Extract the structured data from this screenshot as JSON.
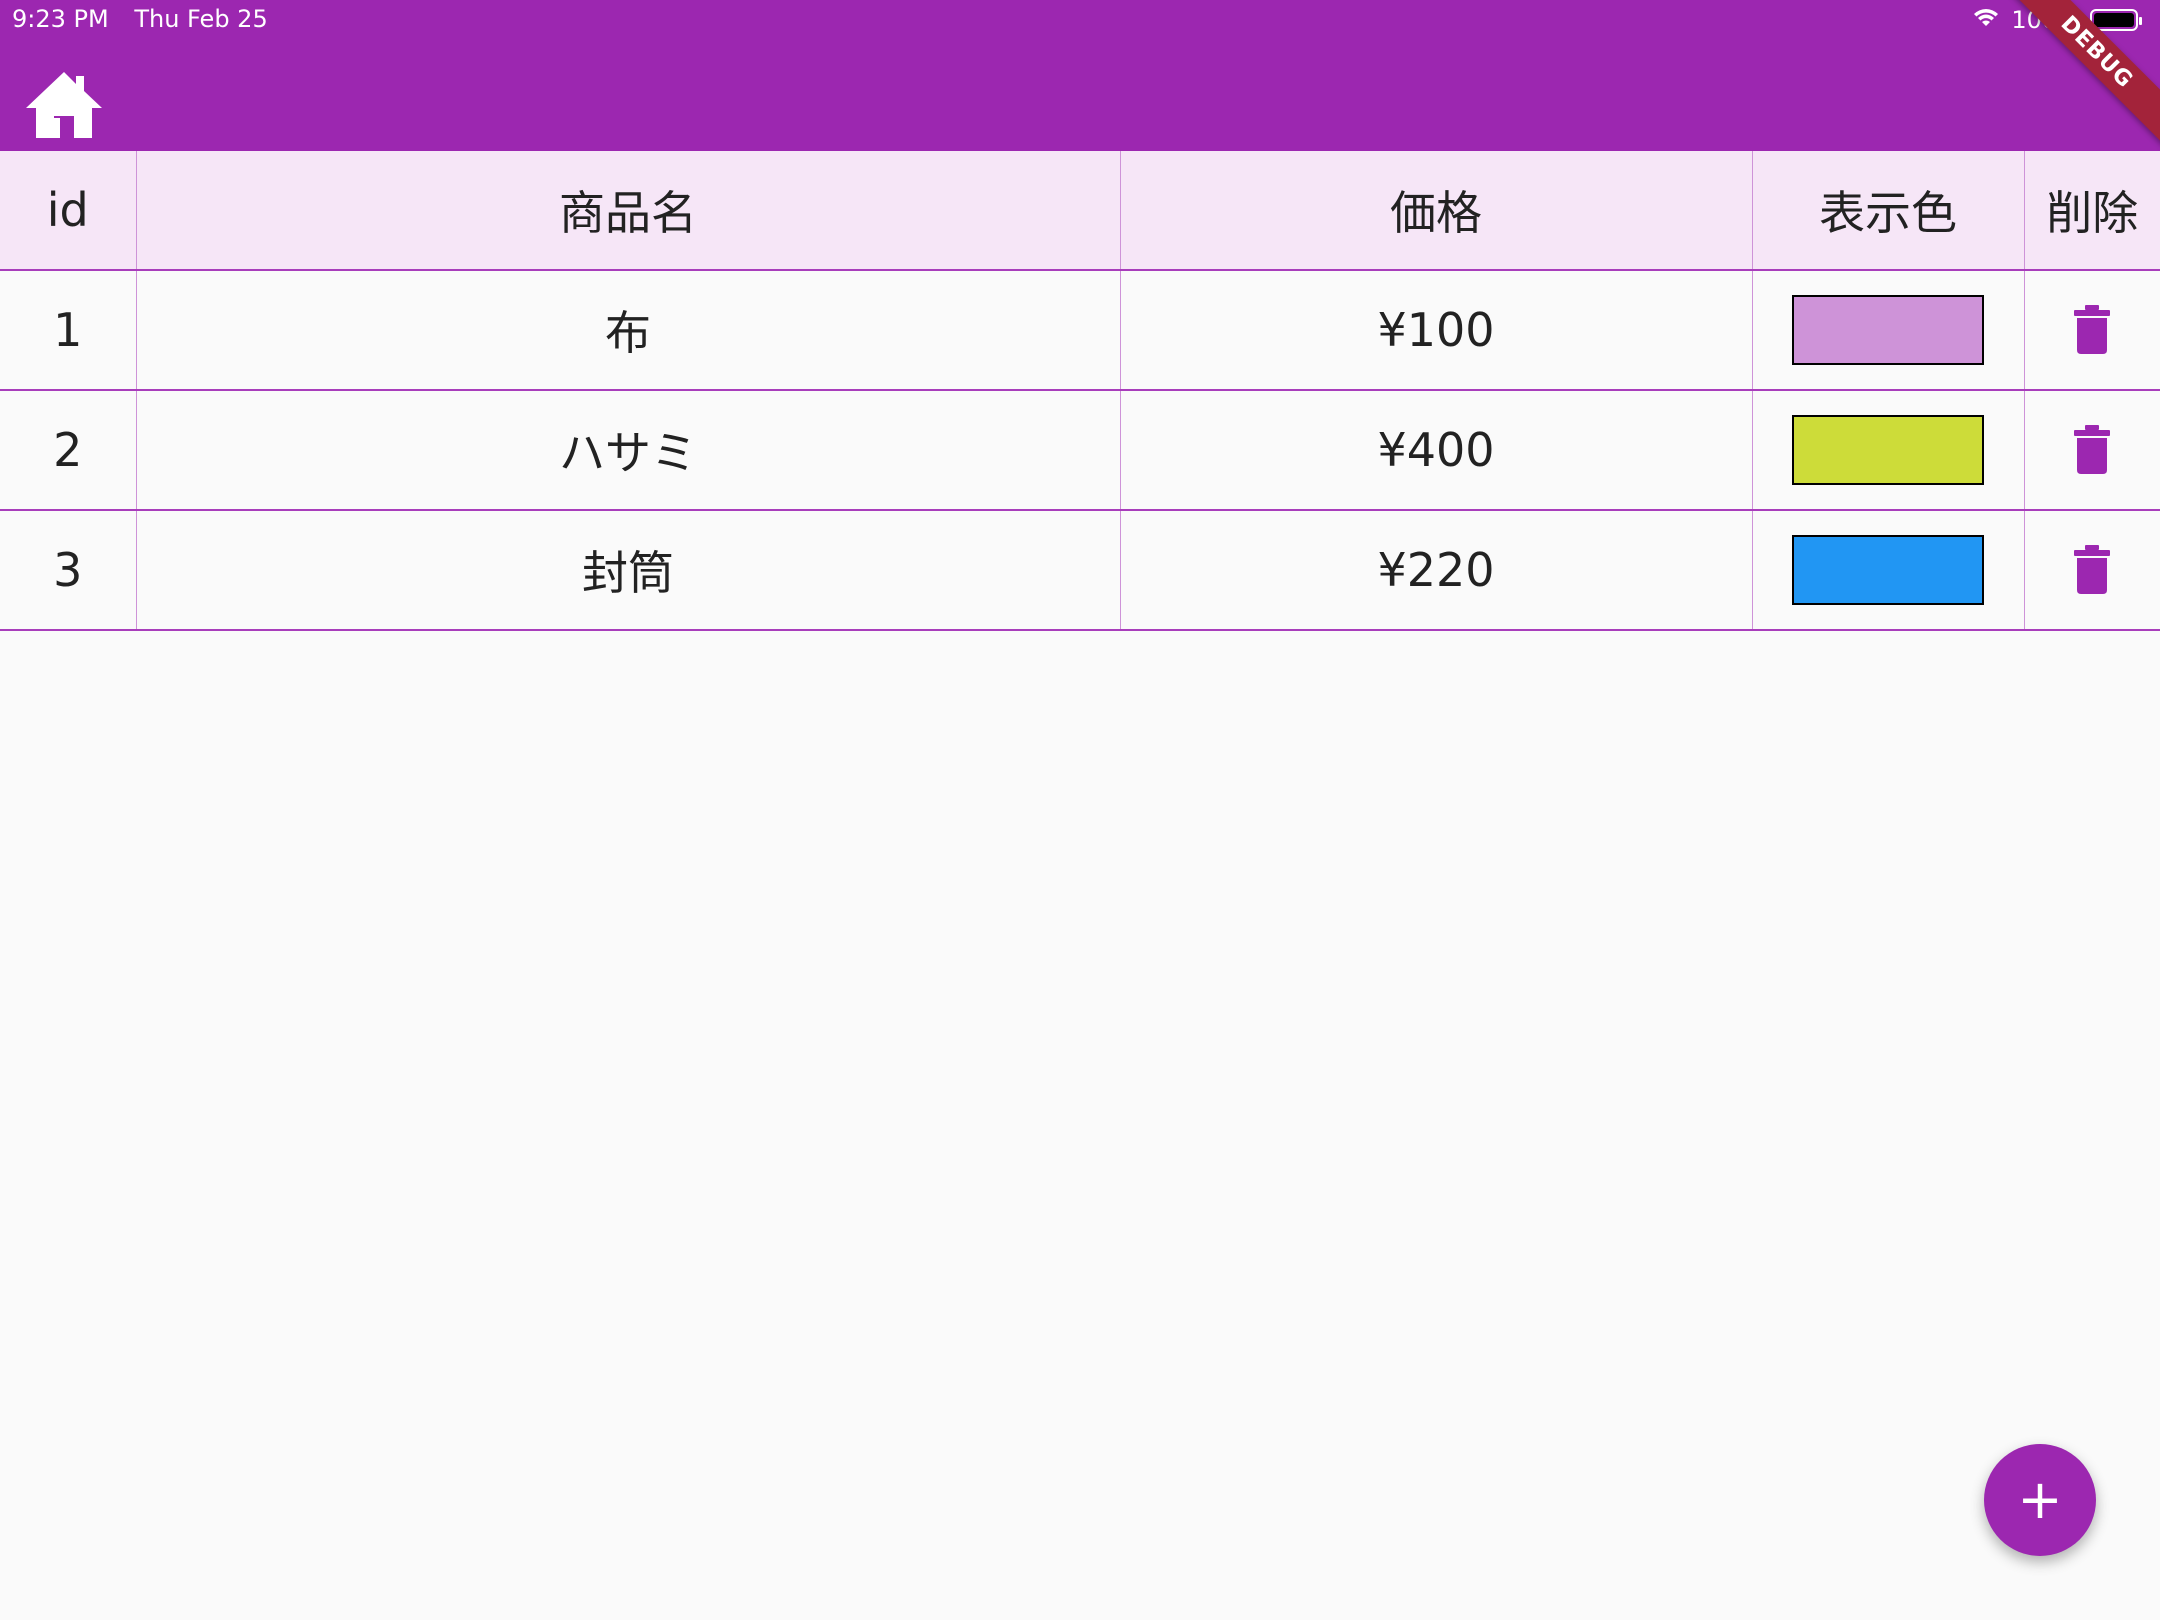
{
  "status_bar": {
    "time": "9:23 PM",
    "date": "Thu Feb 25",
    "battery": "100%",
    "wifi_icon": "wifi-icon",
    "battery_icon": "battery-icon"
  },
  "app_bar": {
    "leading_icon": "home-icon",
    "color": "#9c27b0"
  },
  "debug_banner": "DEBUG",
  "table": {
    "headers": [
      "id",
      "商品名",
      "価格",
      "表示色",
      "削除"
    ],
    "rows": [
      {
        "id": "1",
        "name": "布",
        "price": "¥100",
        "color": "#ce93d8",
        "delete_icon": "trash-icon"
      },
      {
        "id": "2",
        "name": "ハサミ",
        "price": "¥400",
        "color": "#cddc39",
        "delete_icon": "trash-icon"
      },
      {
        "id": "3",
        "name": "封筒",
        "price": "¥220",
        "color": "#2196f3",
        "delete_icon": "trash-icon"
      }
    ]
  },
  "fab": {
    "label": "+",
    "icon": "add-icon"
  },
  "colors": {
    "primary": "#9c27b0",
    "header_bg": "#f6e6f7",
    "divider": "#a83dbb",
    "background": "#fafafa"
  }
}
